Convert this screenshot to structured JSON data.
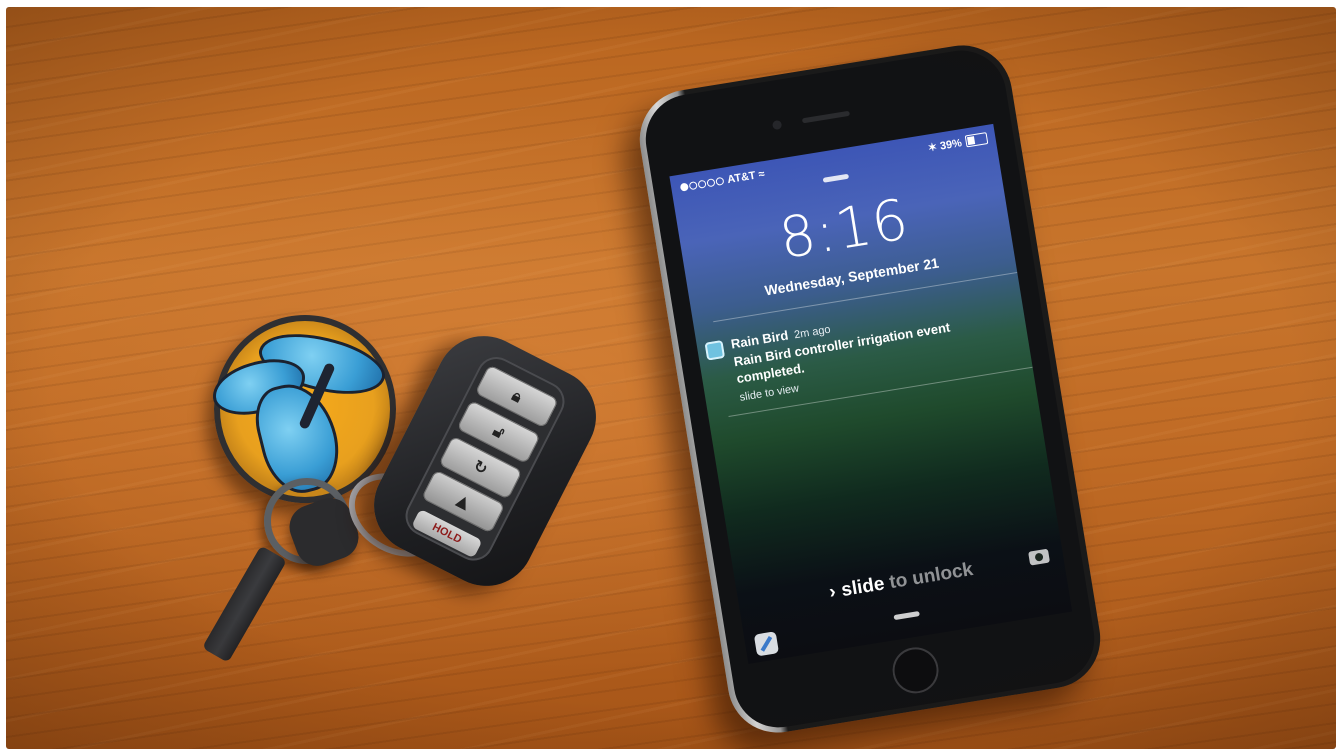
{
  "phone": {
    "status_bar": {
      "carrier": "AT&T",
      "battery_percent": "39%",
      "battery_level": 0.39,
      "signal_dots_filled": 1,
      "signal_dots_total": 5
    },
    "lock_screen": {
      "time": "8:16",
      "date": "Wednesday, September 21"
    },
    "notification": {
      "app": "Rain Bird",
      "age": "2m ago",
      "message": "Rain Bird controller irrigation event completed.",
      "hint": "slide to view",
      "icon": "rain-bird-app-icon"
    },
    "unlock": {
      "chevron": "›",
      "word": "slide",
      "rest": " to unlock"
    },
    "icons": [
      "camera-icon",
      "compass-icon",
      "wifi-icon",
      "bluetooth-icon"
    ]
  },
  "key_fob": {
    "panic_label": "HOLD",
    "buttons": [
      "lock-icon",
      "unlock-icon",
      "remote-start-icon",
      "trunk-icon"
    ]
  },
  "keychain": {
    "icon": "butterfly-icon"
  }
}
